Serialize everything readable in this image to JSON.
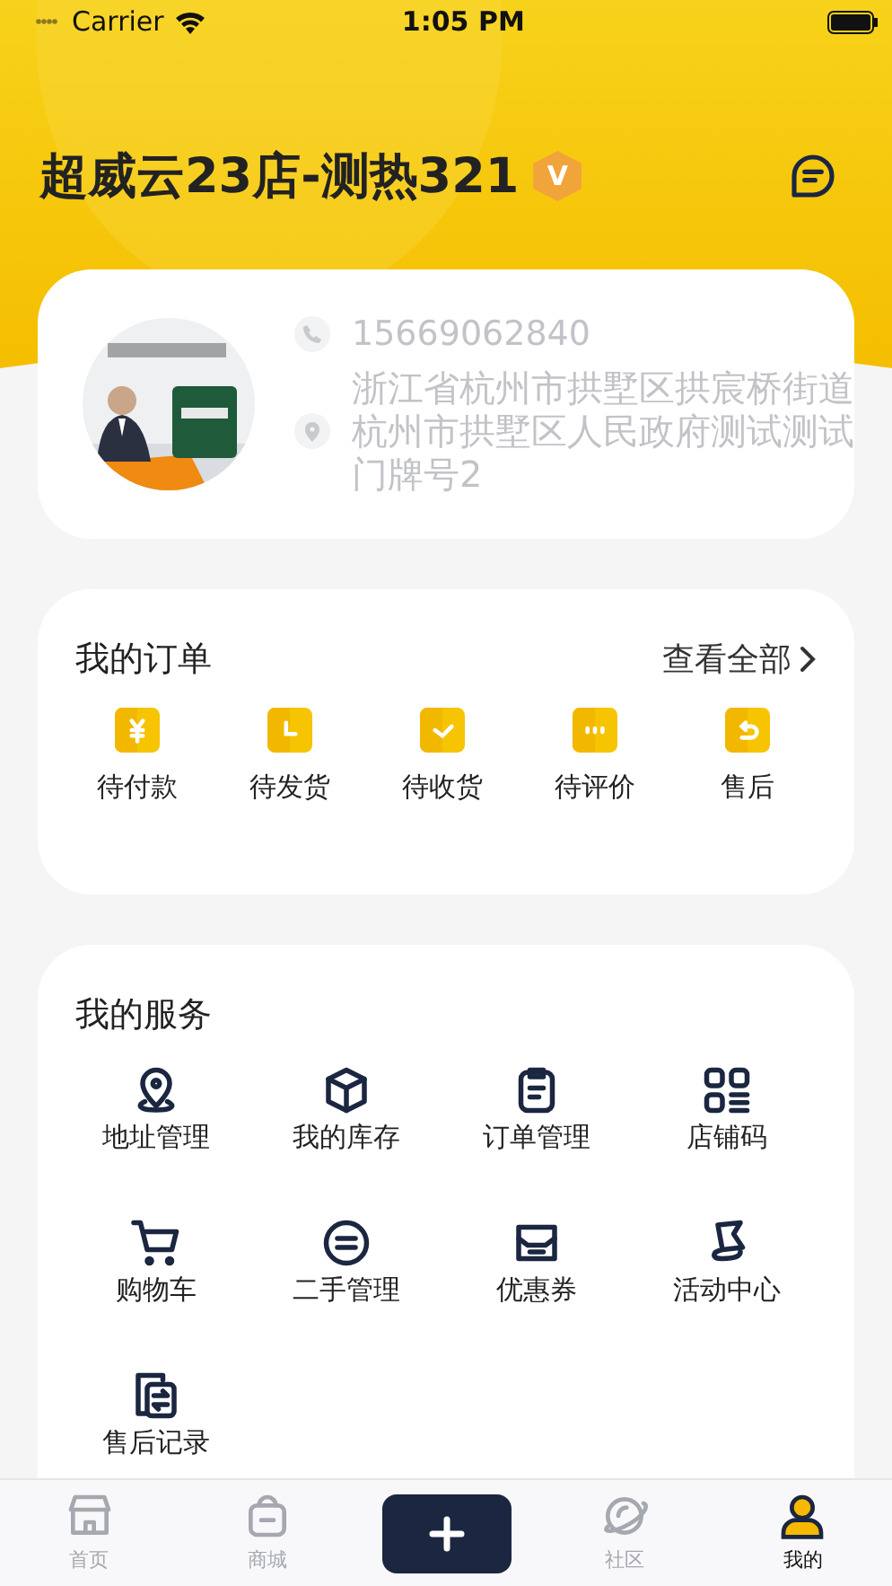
{
  "status_bar": {
    "carrier": "Carrier",
    "time": "1:05 PM"
  },
  "header": {
    "title": "超威云23店-测热321",
    "badge": "V"
  },
  "store_card": {
    "phone": "15669062840",
    "address": "浙江省杭州市拱墅区拱宸桥街道杭州市拱墅区人民政府测试测试门牌号2"
  },
  "orders": {
    "title": "我的订单",
    "view_all": "查看全部",
    "items": [
      {
        "label": "待付款",
        "kind": "payment"
      },
      {
        "label": "待发货",
        "kind": "ship"
      },
      {
        "label": "待收货",
        "kind": "receive"
      },
      {
        "label": "待评价",
        "kind": "review"
      },
      {
        "label": "售后",
        "kind": "return"
      }
    ]
  },
  "services": {
    "title": "我的服务",
    "items": [
      {
        "label": "地址管理",
        "kind": "address"
      },
      {
        "label": "我的库存",
        "kind": "stock"
      },
      {
        "label": "订单管理",
        "kind": "orders"
      },
      {
        "label": "店铺码",
        "kind": "qr"
      },
      {
        "label": "购物车",
        "kind": "cart"
      },
      {
        "label": "二手管理",
        "kind": "secondhand"
      },
      {
        "label": "优惠券",
        "kind": "coupon"
      },
      {
        "label": "活动中心",
        "kind": "activity"
      },
      {
        "label": "售后记录",
        "kind": "records"
      }
    ]
  },
  "tab_bar": {
    "items": [
      {
        "label": "首页",
        "kind": "home",
        "selected": false
      },
      {
        "label": "商城",
        "kind": "mall",
        "selected": false
      },
      {
        "kind": "add",
        "selected": false
      },
      {
        "label": "社区",
        "kind": "community",
        "selected": false
      },
      {
        "label": "我的",
        "kind": "me",
        "selected": true
      }
    ]
  }
}
